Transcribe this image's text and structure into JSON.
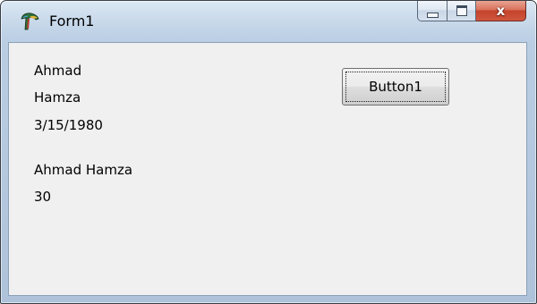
{
  "window": {
    "title": "Form1",
    "icon": "delphi-app-icon",
    "caption_buttons": {
      "minimize_icon": "minimize-icon",
      "maximize_icon": "maximize-icon",
      "close_icon": "close-icon",
      "close_glyph": "x"
    }
  },
  "form": {
    "labels": {
      "first_name": "Ahmad",
      "last_name": "Hamza",
      "birth_date": "3/15/1980",
      "full_name": "Ahmad Hamza",
      "age": "30"
    },
    "button": {
      "label": "Button1"
    }
  },
  "colors": {
    "client_background": "#f0f0f0",
    "close_button": "#c4432b",
    "titlebar": "#c3d5e8"
  }
}
